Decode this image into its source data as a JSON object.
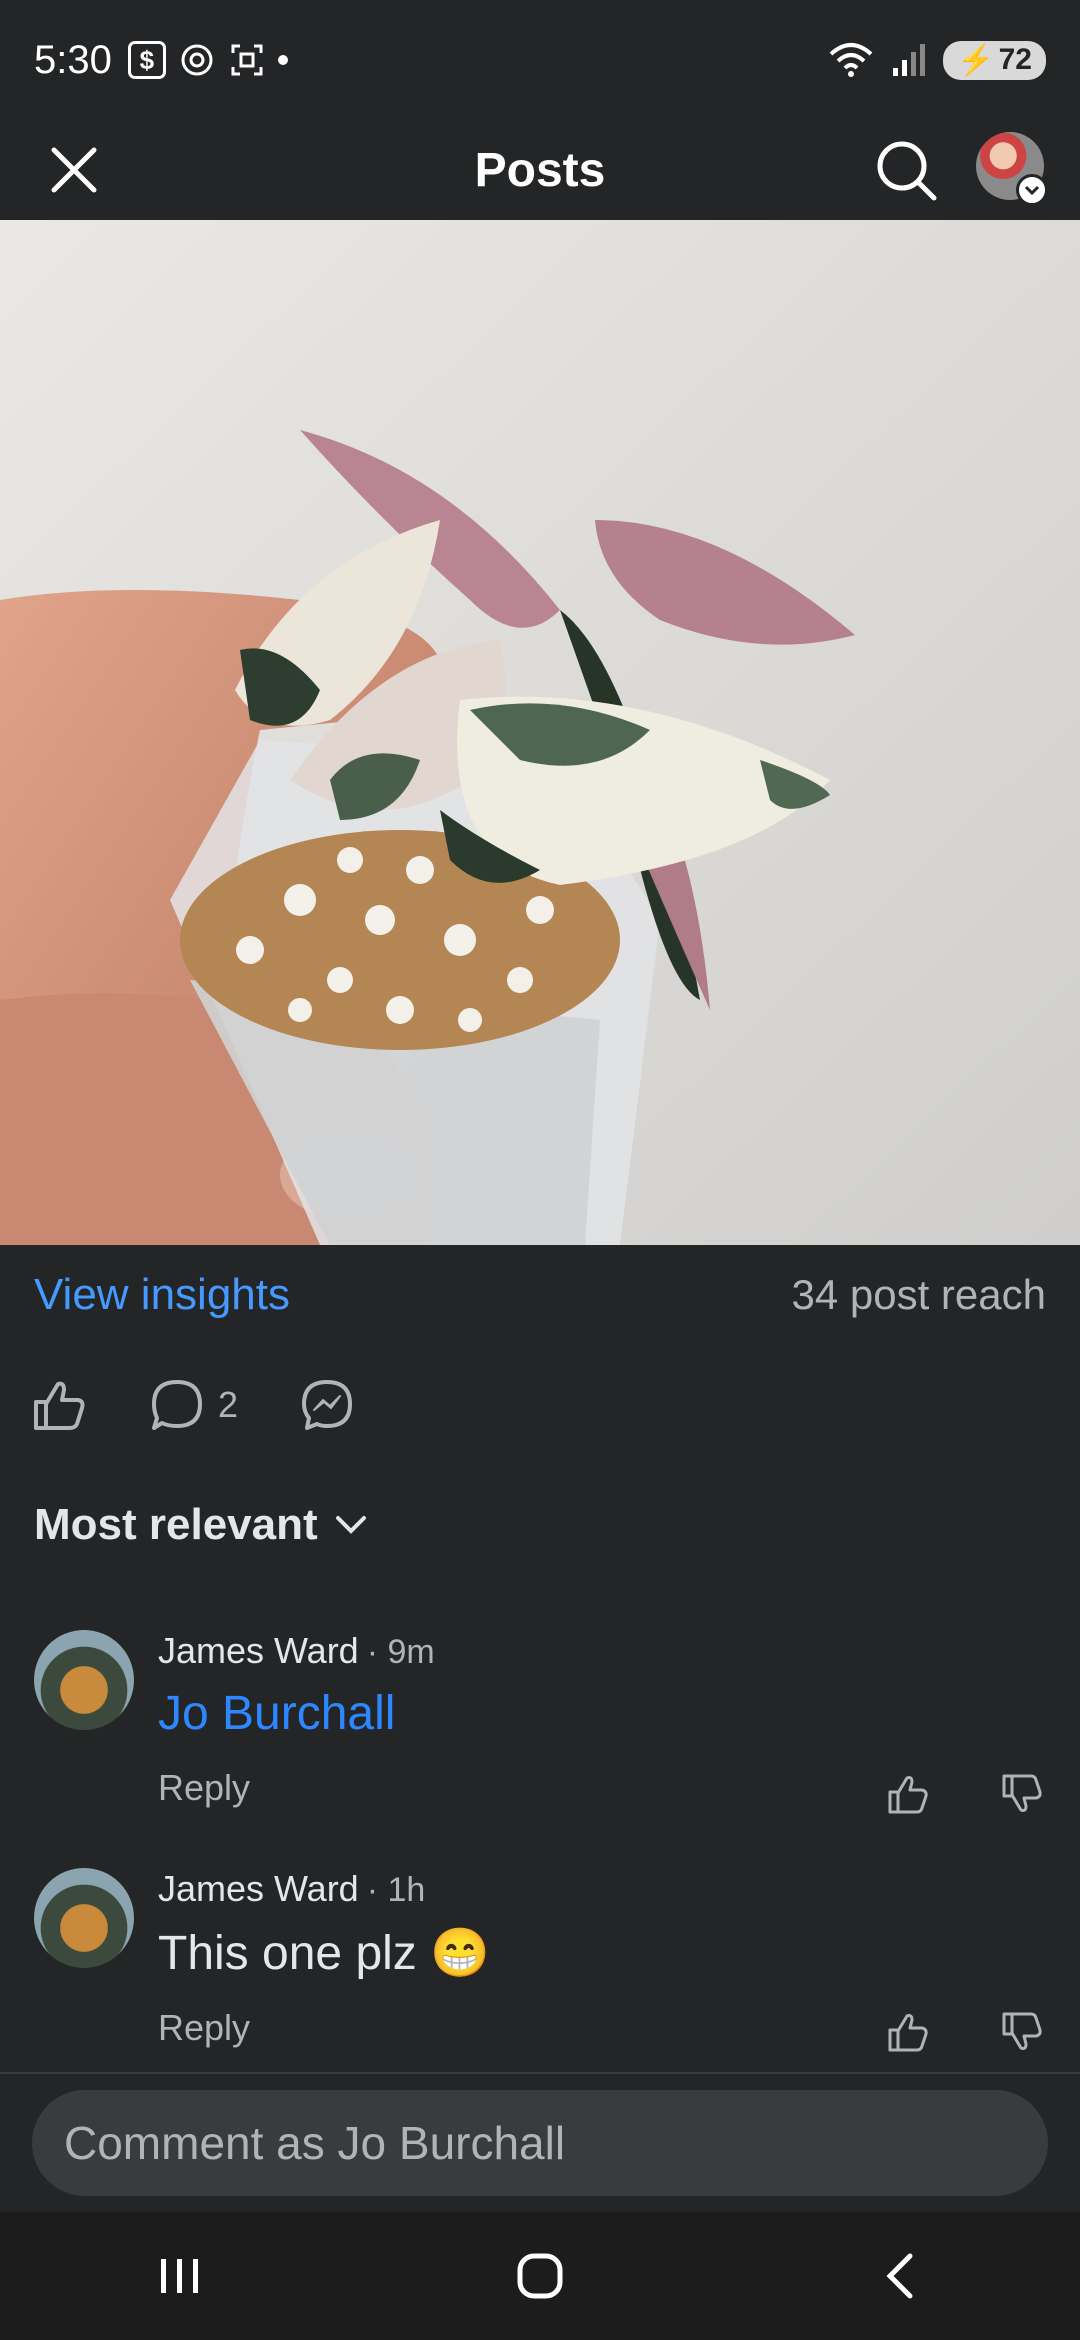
{
  "status": {
    "time": "5:30",
    "battery": "72",
    "wifi_label": "6"
  },
  "header": {
    "title": "Posts"
  },
  "insights": {
    "view_label": "View insights",
    "reach_label": "34 post reach"
  },
  "actions": {
    "comment_count": "2"
  },
  "sort": {
    "label": "Most relevant"
  },
  "comments": [
    {
      "author": "James Ward",
      "time": "· 9m",
      "mention": "Jo Burchall",
      "reply": "Reply"
    },
    {
      "author": "James Ward",
      "time": "· 1h",
      "text": "This one plz 😁",
      "reply": "Reply"
    }
  ],
  "composer": {
    "placeholder": "Comment as Jo Burchall"
  },
  "colors": {
    "background": "#242526",
    "link": "#4599ff",
    "mention": "#2d88ff",
    "secondary_text": "#b0b3b8"
  }
}
